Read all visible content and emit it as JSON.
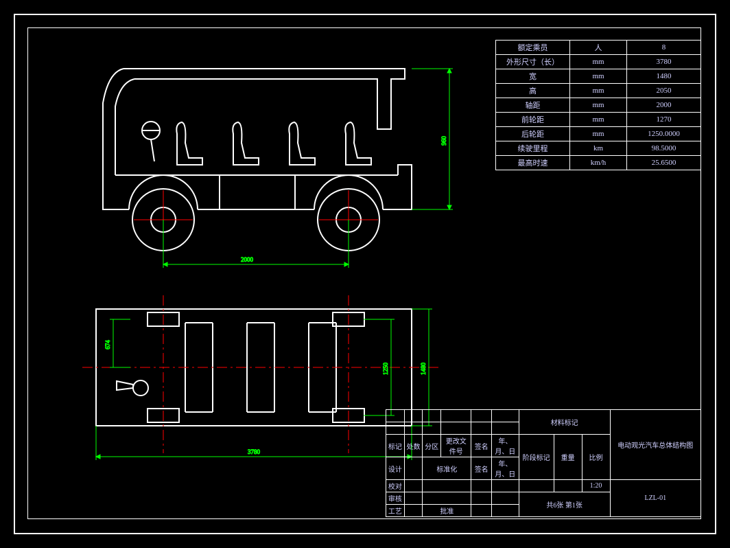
{
  "spec_table": {
    "rows": [
      {
        "label": "额定乘员",
        "unit": "人",
        "value": "8"
      },
      {
        "label": "外形尺寸（长）",
        "unit": "mm",
        "value": "3780"
      },
      {
        "label": "宽",
        "unit": "mm",
        "value": "1480"
      },
      {
        "label": "高",
        "unit": "mm",
        "value": "2050"
      },
      {
        "label": "轴距",
        "unit": "mm",
        "value": "2000"
      },
      {
        "label": "前轮距",
        "unit": "mm",
        "value": "1270"
      },
      {
        "label": "后轮距",
        "unit": "mm",
        "value": "1250.0000"
      },
      {
        "label": "续驶里程",
        "unit": "km",
        "value": "98.5000"
      },
      {
        "label": "最高时速",
        "unit": "km/h",
        "value": "25.6500"
      }
    ]
  },
  "dimensions": {
    "wheelbase": "2000",
    "length": "3780",
    "height": "960",
    "half_width": "674",
    "track": "1250",
    "body_width": "1480"
  },
  "title_block": {
    "material_mark": "材料标记",
    "drawing_title": "电动观光汽车总体结构图",
    "drawing_number": "LZL-01",
    "stage_mark": "阶段标记",
    "weight": "重量",
    "scale_label": "比例",
    "scale_value": "1:20",
    "sheet_info": "共6张 第1张",
    "row_labels": {
      "mark": "标记",
      "area": "处数",
      "zone": "分区",
      "change_doc": "更改文件号",
      "sign": "签名",
      "date": "年、月、日",
      "design": "设计",
      "standard": "标准化",
      "sign2": "签名",
      "date2": "年、月、日",
      "check": "校对",
      "review": "审核",
      "process": "工艺",
      "approve": "批准"
    }
  }
}
